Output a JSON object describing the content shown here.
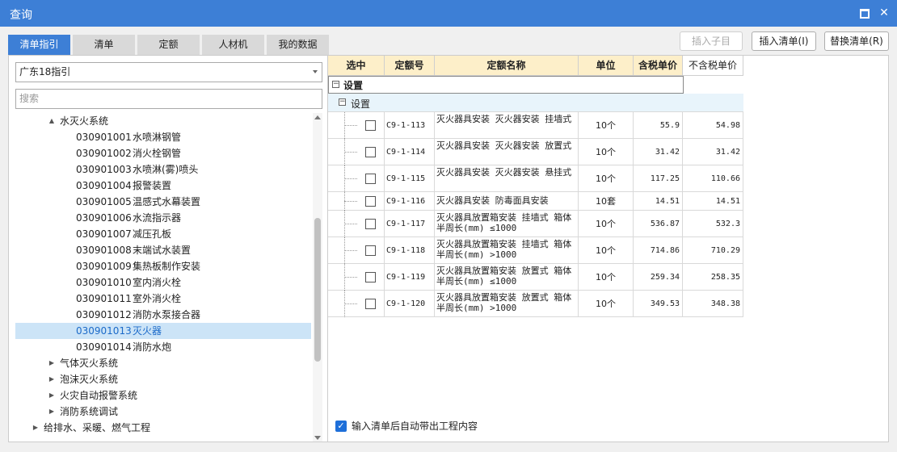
{
  "window": {
    "title": "查询"
  },
  "tabs": [
    "清单指引",
    "清单",
    "定额",
    "人材机",
    "我的数据"
  ],
  "buttons": {
    "insert_child": "插入子目",
    "insert_list": "插入清单(I)",
    "replace_list": "替换清单(R)"
  },
  "left": {
    "combo_value": "广东18指引",
    "search_placeholder": "搜索",
    "tree": [
      {
        "code": "",
        "label": "水灭火系统",
        "level": 2,
        "twisty": "▲",
        "selected": false
      },
      {
        "code": "030901001",
        "label": "水喷淋钢管",
        "level": 3,
        "twisty": "",
        "selected": false
      },
      {
        "code": "030901002",
        "label": "消火栓钢管",
        "level": 3,
        "twisty": "",
        "selected": false
      },
      {
        "code": "030901003",
        "label": "水喷淋(雾)喷头",
        "level": 3,
        "twisty": "",
        "selected": false
      },
      {
        "code": "030901004",
        "label": "报警装置",
        "level": 3,
        "twisty": "",
        "selected": false
      },
      {
        "code": "030901005",
        "label": "温感式水幕装置",
        "level": 3,
        "twisty": "",
        "selected": false
      },
      {
        "code": "030901006",
        "label": "水流指示器",
        "level": 3,
        "twisty": "",
        "selected": false
      },
      {
        "code": "030901007",
        "label": "减压孔板",
        "level": 3,
        "twisty": "",
        "selected": false
      },
      {
        "code": "030901008",
        "label": "末端试水装置",
        "level": 3,
        "twisty": "",
        "selected": false
      },
      {
        "code": "030901009",
        "label": "集热板制作安装",
        "level": 3,
        "twisty": "",
        "selected": false
      },
      {
        "code": "030901010",
        "label": "室内消火栓",
        "level": 3,
        "twisty": "",
        "selected": false
      },
      {
        "code": "030901011",
        "label": "室外消火栓",
        "level": 3,
        "twisty": "",
        "selected": false
      },
      {
        "code": "030901012",
        "label": "消防水泵接合器",
        "level": 3,
        "twisty": "",
        "selected": false
      },
      {
        "code": "030901013",
        "label": "灭火器",
        "level": 3,
        "twisty": "",
        "selected": true
      },
      {
        "code": "030901014",
        "label": "消防水炮",
        "level": 3,
        "twisty": "",
        "selected": false
      },
      {
        "code": "",
        "label": "气体灭火系统",
        "level": 2,
        "twisty": "▶",
        "selected": false
      },
      {
        "code": "",
        "label": "泡沫灭火系统",
        "level": 2,
        "twisty": "▶",
        "selected": false
      },
      {
        "code": "",
        "label": "火灾自动报警系统",
        "level": 2,
        "twisty": "▶",
        "selected": false
      },
      {
        "code": "",
        "label": "消防系统调试",
        "level": 2,
        "twisty": "▶",
        "selected": false
      },
      {
        "code": "",
        "label": "给排水、采暖、燃气工程",
        "level": 1,
        "twisty": "▶",
        "selected": false
      }
    ]
  },
  "grid": {
    "headers": [
      "选中",
      "定额号",
      "定额名称",
      "单位",
      "含税单价",
      "不含税单价"
    ],
    "group1": "设置",
    "group2": "设置",
    "rows": [
      {
        "code": "C9-1-113",
        "name": "灭火器具安装 灭火器安装 挂墙式",
        "unit": "10个",
        "price_tax": "55.9",
        "price_notax": "54.98"
      },
      {
        "code": "C9-1-114",
        "name": "灭火器具安装 灭火器安装 放置式",
        "unit": "10个",
        "price_tax": "31.42",
        "price_notax": "31.42"
      },
      {
        "code": "C9-1-115",
        "name": "灭火器具安装 灭火器安装 悬挂式",
        "unit": "10个",
        "price_tax": "117.25",
        "price_notax": "110.66"
      },
      {
        "code": "C9-1-116",
        "name": "灭火器具安装 防毒面具安装",
        "unit": "10套",
        "price_tax": "14.51",
        "price_notax": "14.51"
      },
      {
        "code": "C9-1-117",
        "name": "灭火器具放置箱安装 挂墙式 箱体半周长(mm) ≤1000",
        "unit": "10个",
        "price_tax": "536.87",
        "price_notax": "532.3"
      },
      {
        "code": "C9-1-118",
        "name": "灭火器具放置箱安装 挂墙式 箱体半周长(mm) >1000",
        "unit": "10个",
        "price_tax": "714.86",
        "price_notax": "710.29"
      },
      {
        "code": "C9-1-119",
        "name": "灭火器具放置箱安装 放置式 箱体半周长(mm) ≤1000",
        "unit": "10个",
        "price_tax": "259.34",
        "price_notax": "258.35"
      },
      {
        "code": "C9-1-120",
        "name": "灭火器具放置箱安装 放置式 箱体半周长(mm) >1000",
        "unit": "10个",
        "price_tax": "349.53",
        "price_notax": "348.38"
      }
    ]
  },
  "footer": {
    "auto_content_label": "输入清单后自动带出工程内容",
    "auto_content_checked": true
  }
}
